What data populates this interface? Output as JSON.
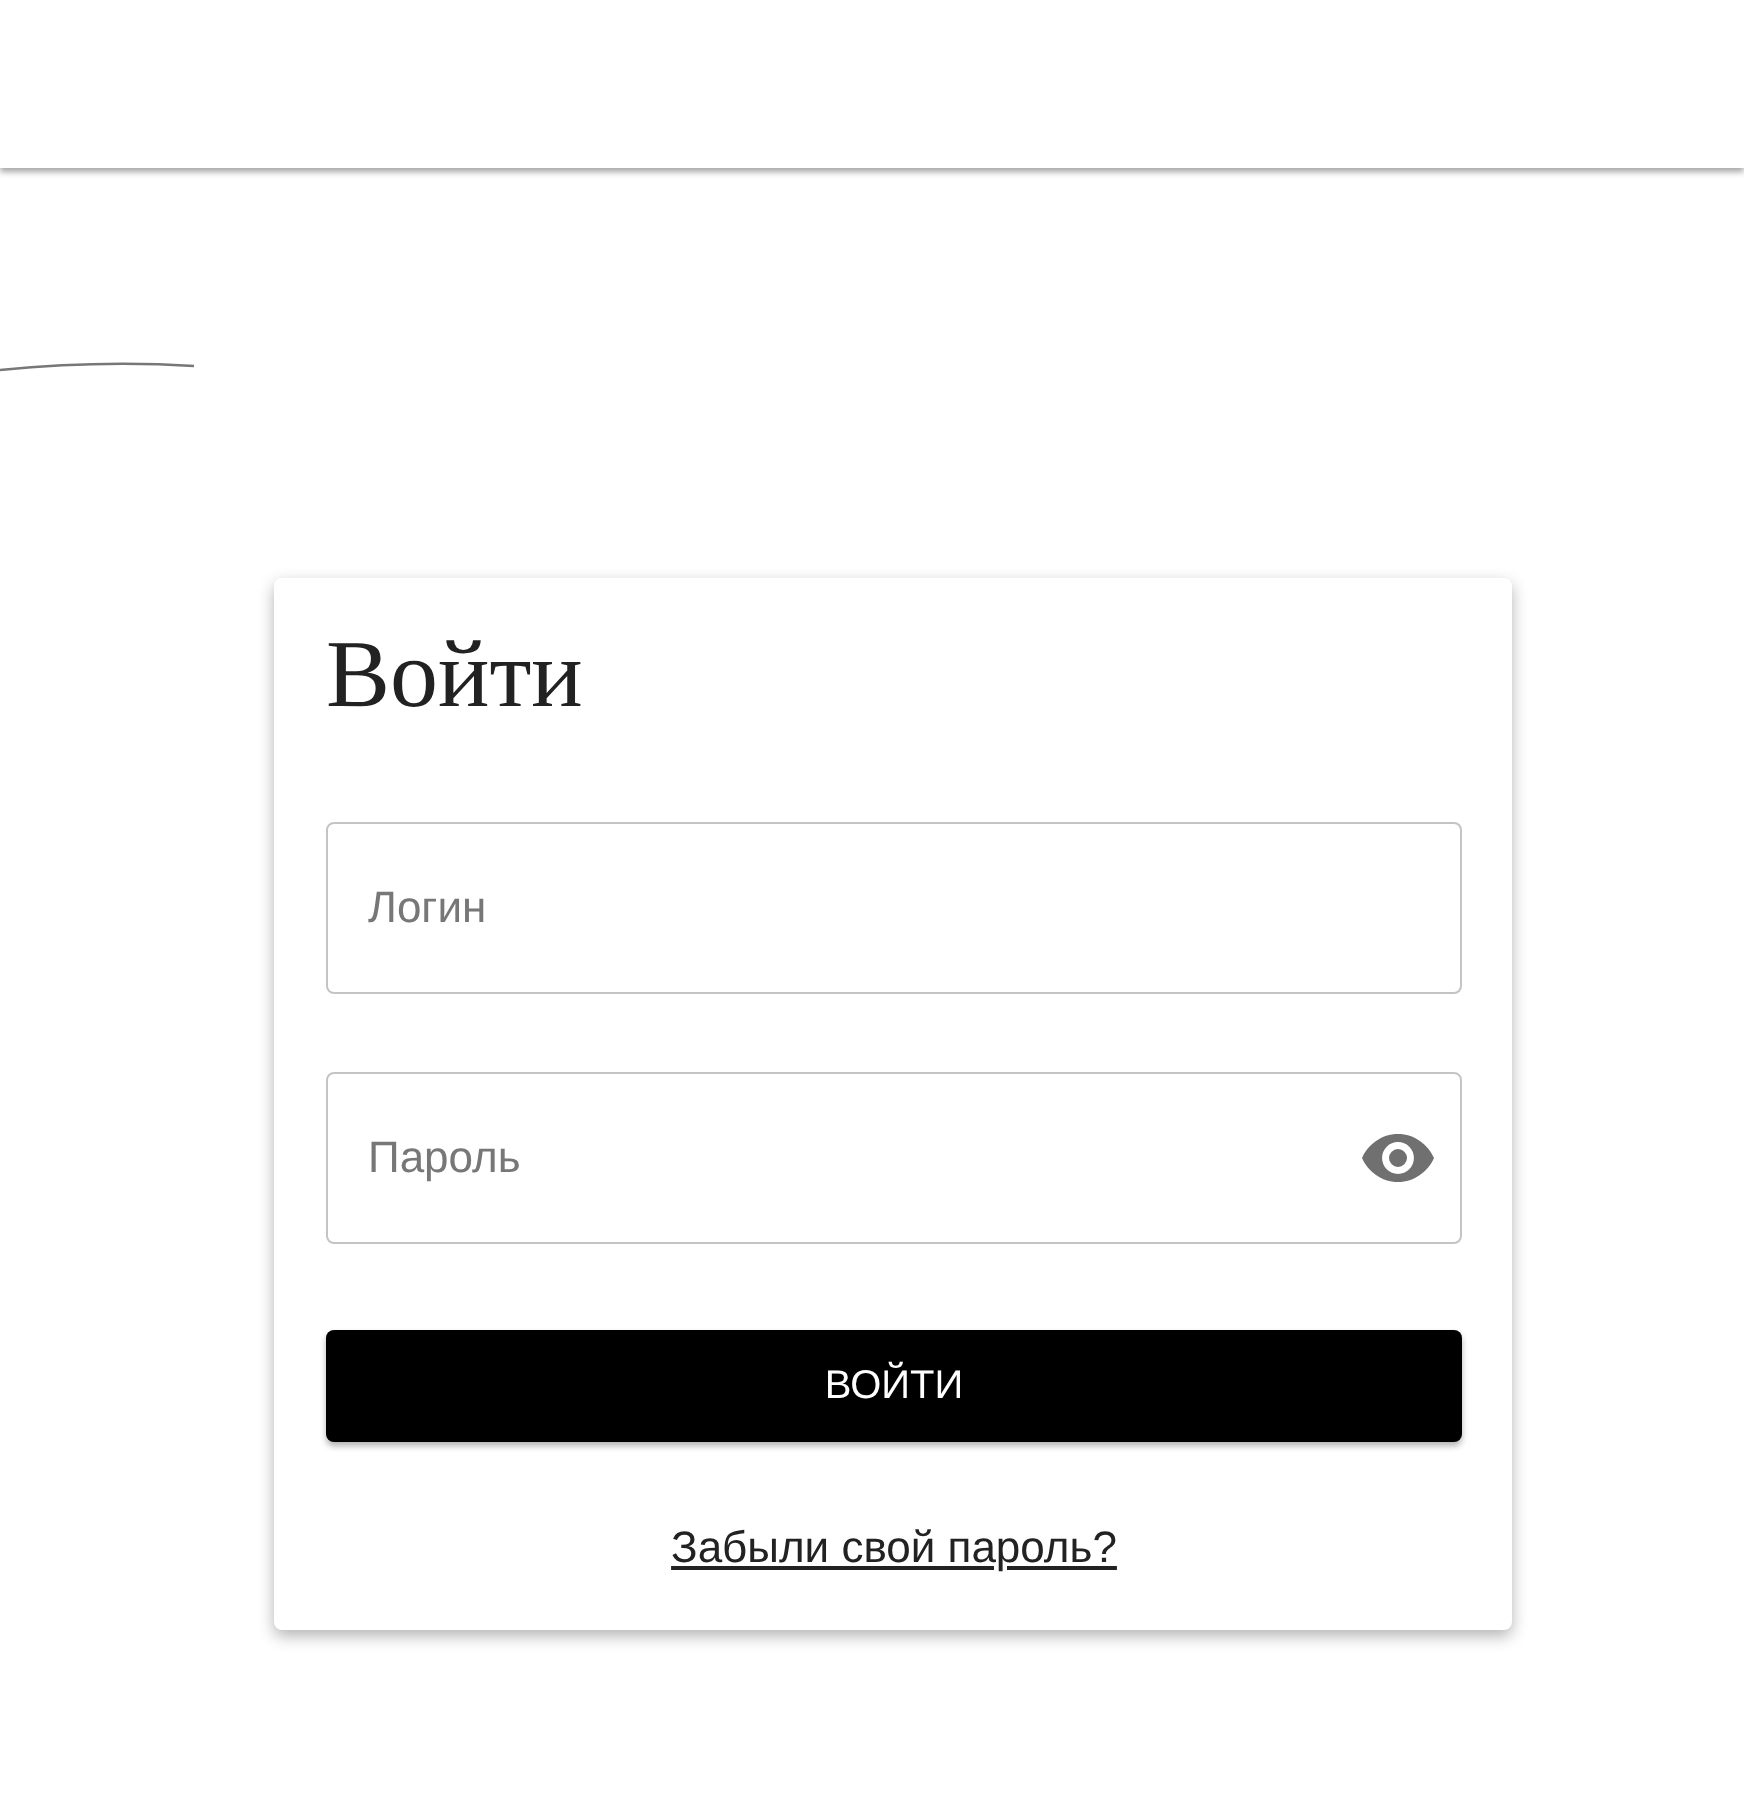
{
  "login_card": {
    "title": "Войти",
    "fields": [
      {
        "kind": "text",
        "placeholder": "Логин"
      },
      {
        "kind": "password",
        "placeholder": "Пароль"
      }
    ],
    "submit_button": "ВОЙТИ",
    "forgot_link": "Забыли свой пароль?"
  }
}
